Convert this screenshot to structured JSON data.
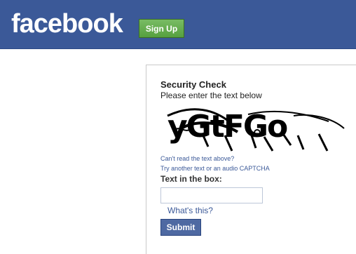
{
  "header": {
    "logo_text": "facebook",
    "signup_label": "Sign Up",
    "brand_color": "#3b5998",
    "signup_color": "#69a74e"
  },
  "security": {
    "title": "Security Check",
    "instruction": "Please enter the text below",
    "captcha_text": "yGtFGo",
    "cant_read": "Can't read the text above?",
    "alternatives": "Try another text or an audio CAPTCHA",
    "field_label": "Text in the box:",
    "input_value": "",
    "whats_this": "What's this?",
    "submit_label": "Submit"
  }
}
